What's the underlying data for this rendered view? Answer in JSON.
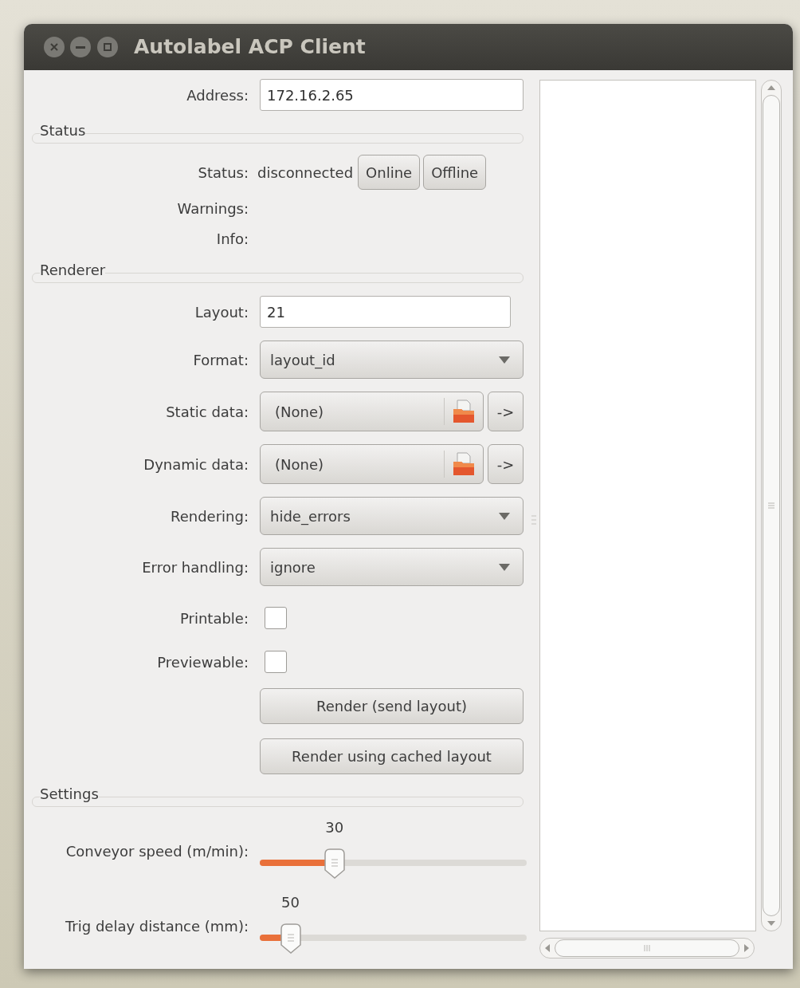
{
  "window": {
    "title": "Autolabel ACP Client"
  },
  "address": {
    "label": "Address:",
    "value": "172.16.2.65"
  },
  "sections": [
    {
      "title": "Status",
      "rows": [
        {
          "kind": "status",
          "label": "Status:",
          "value": "disconnected",
          "buttons": [
            "Online",
            "Offline"
          ]
        },
        {
          "kind": "text",
          "label": "Warnings:"
        },
        {
          "kind": "text",
          "label": "Info:"
        }
      ]
    },
    {
      "title": "Renderer",
      "rows": [
        {
          "kind": "input",
          "label": "Layout:",
          "value": "21"
        },
        {
          "kind": "dropdown",
          "label": "Format:",
          "value": "layout_id"
        },
        {
          "kind": "file",
          "label": "Static data:",
          "value": "(None)",
          "button": "->"
        },
        {
          "kind": "file",
          "label": "Dynamic data:",
          "value": "(None)",
          "button": "->"
        },
        {
          "kind": "dropdown",
          "label": "Rendering:",
          "value": "hide_errors"
        },
        {
          "kind": "dropdown",
          "label": "Error handling:",
          "value": "ignore"
        },
        {
          "kind": "checkbox",
          "label": "Printable:",
          "checked": false
        },
        {
          "kind": "checkbox",
          "label": "Previewable:",
          "checked": false
        },
        {
          "kind": "button",
          "label": "Render (send layout)"
        },
        {
          "kind": "button",
          "label": "Render using cached layout"
        }
      ]
    },
    {
      "title": "Settings",
      "rows": [
        {
          "kind": "slider",
          "label": "Conveyor speed (m/min):",
          "reading": "30",
          "level": 0.26
        },
        {
          "kind": "slider",
          "label": "Trig delay distance (mm):",
          "reading": "50",
          "level": 0.08
        }
      ]
    }
  ]
}
